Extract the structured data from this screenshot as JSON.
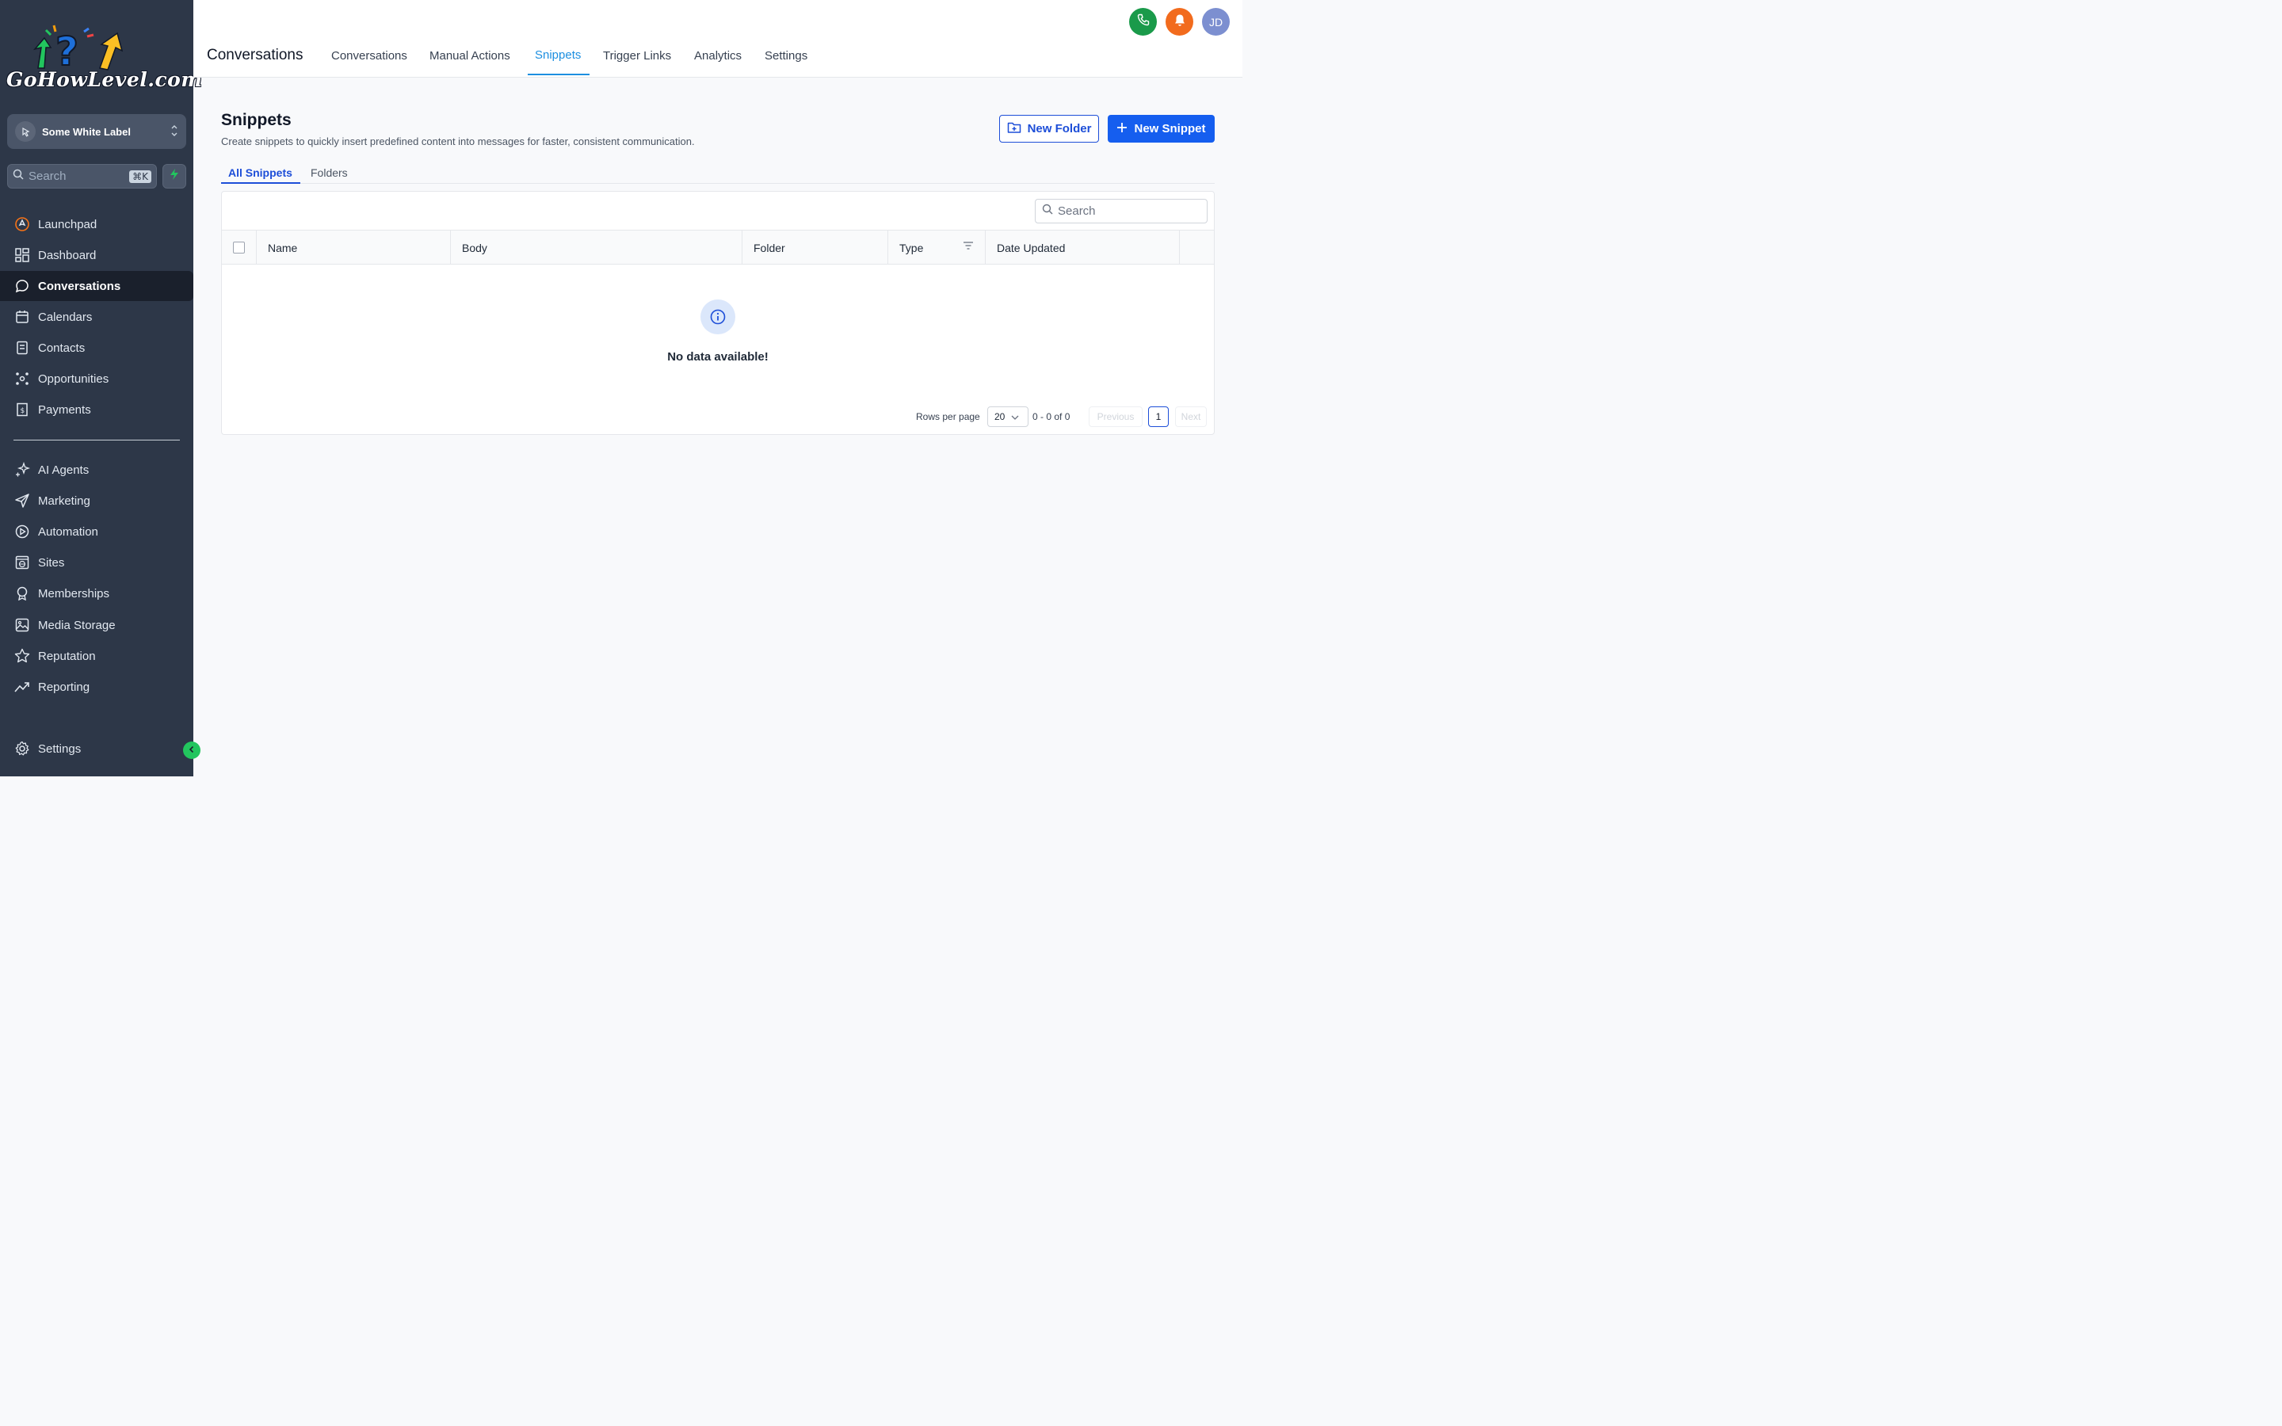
{
  "brand": {
    "logo_text": "GoHowLevel.com",
    "colors": {
      "sidebar_bg": "#2d3748",
      "active_tab": "#1d8fe0",
      "primary": "#155eef",
      "call_btn": "#1a9a4a",
      "notify_btn": "#f26b1d",
      "avatar_bg": "#7c8fd0",
      "collapse_btn": "#22c55e"
    }
  },
  "sidebar": {
    "account": {
      "label": "Some White Label",
      "icon": "cursor-click-icon"
    },
    "search": {
      "placeholder": "Search",
      "shortcut": "⌘K"
    },
    "quick_action_icon": "bolt-icon",
    "items": [
      {
        "label": "Launchpad",
        "icon": "rocket-icon"
      },
      {
        "label": "Dashboard",
        "icon": "grid-icon"
      },
      {
        "label": "Conversations",
        "icon": "chat-icon",
        "active": true
      },
      {
        "label": "Calendars",
        "icon": "calendar-icon"
      },
      {
        "label": "Contacts",
        "icon": "contacts-icon"
      },
      {
        "label": "Opportunities",
        "icon": "funnel-icon"
      },
      {
        "label": "Payments",
        "icon": "receipt-icon"
      },
      {
        "label": "AI Agents",
        "icon": "sparkle-icon"
      },
      {
        "label": "Marketing",
        "icon": "send-icon"
      },
      {
        "label": "Automation",
        "icon": "play-circle-icon"
      },
      {
        "label": "Sites",
        "icon": "globe-icon"
      },
      {
        "label": "Memberships",
        "icon": "award-icon"
      },
      {
        "label": "Media Storage",
        "icon": "image-icon"
      },
      {
        "label": "Reputation",
        "icon": "star-icon"
      },
      {
        "label": "Reporting",
        "icon": "trend-icon"
      }
    ],
    "settings": {
      "label": "Settings",
      "icon": "gear-icon"
    }
  },
  "header": {
    "title": "Conversations",
    "tabs": [
      {
        "label": "Conversations"
      },
      {
        "label": "Manual Actions"
      },
      {
        "label": "Snippets",
        "active": true
      },
      {
        "label": "Trigger Links"
      },
      {
        "label": "Analytics"
      },
      {
        "label": "Settings"
      }
    ],
    "avatar_initials": "JD"
  },
  "main": {
    "title": "Snippets",
    "subtitle": "Create snippets to quickly insert predefined content into messages for faster, consistent communication.",
    "new_folder_label": "New Folder",
    "new_snippet_label": "New Snippet",
    "subtabs": [
      {
        "label": "All Snippets",
        "active": true
      },
      {
        "label": "Folders"
      }
    ],
    "table": {
      "search_placeholder": "Search",
      "columns": [
        "Name",
        "Body",
        "Folder",
        "Type",
        "Date Updated"
      ],
      "empty_message": "No data available!",
      "rows": []
    },
    "pagination": {
      "rows_per_page_label": "Rows per page",
      "rows_per_page": "20",
      "range_text": "0 - 0 of 0",
      "previous_label": "Previous",
      "current_page": "1",
      "next_label": "Next"
    }
  }
}
